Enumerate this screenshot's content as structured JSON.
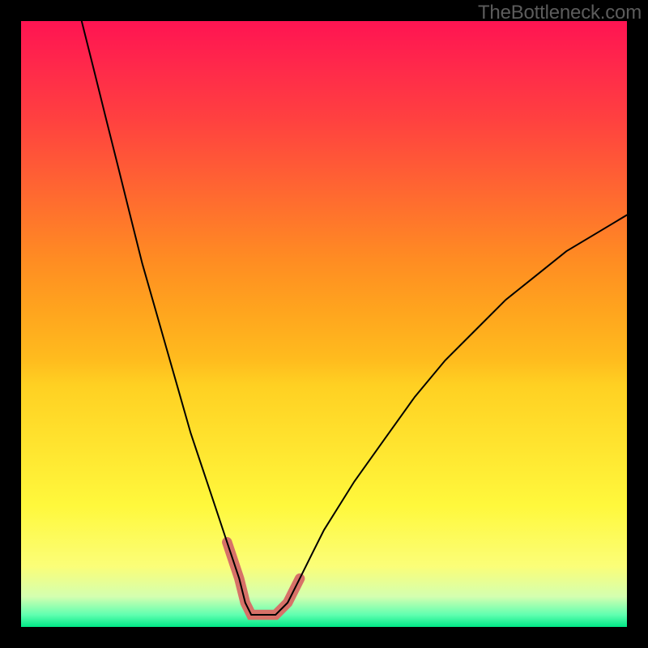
{
  "attribution": "TheBottleneck.com",
  "chart_data": {
    "type": "line",
    "title": "",
    "xlabel": "",
    "ylabel": "",
    "x_range": [
      0,
      100
    ],
    "y_range": [
      0,
      100
    ],
    "gradient_meaning": "bottleneck severity (red=high, green=low)",
    "series": [
      {
        "name": "main-curve",
        "x": [
          10,
          12,
          14,
          16,
          18,
          20,
          22,
          24,
          26,
          28,
          30,
          32,
          34,
          36,
          37,
          38,
          40,
          42,
          44,
          46,
          48,
          50,
          55,
          60,
          65,
          70,
          75,
          80,
          85,
          90,
          95,
          100
        ],
        "values": [
          100,
          92,
          84,
          76,
          68,
          60,
          53,
          46,
          39,
          32,
          26,
          20,
          14,
          8,
          4,
          2,
          2,
          2,
          4,
          8,
          12,
          16,
          24,
          31,
          38,
          44,
          49,
          54,
          58,
          62,
          65,
          68
        ]
      },
      {
        "name": "highlight-band",
        "x": [
          34,
          36,
          37,
          38,
          40,
          42,
          44,
          46
        ],
        "values": [
          14,
          8,
          4,
          2,
          2,
          2,
          4,
          8
        ]
      }
    ],
    "minimum_at_x": 40
  }
}
